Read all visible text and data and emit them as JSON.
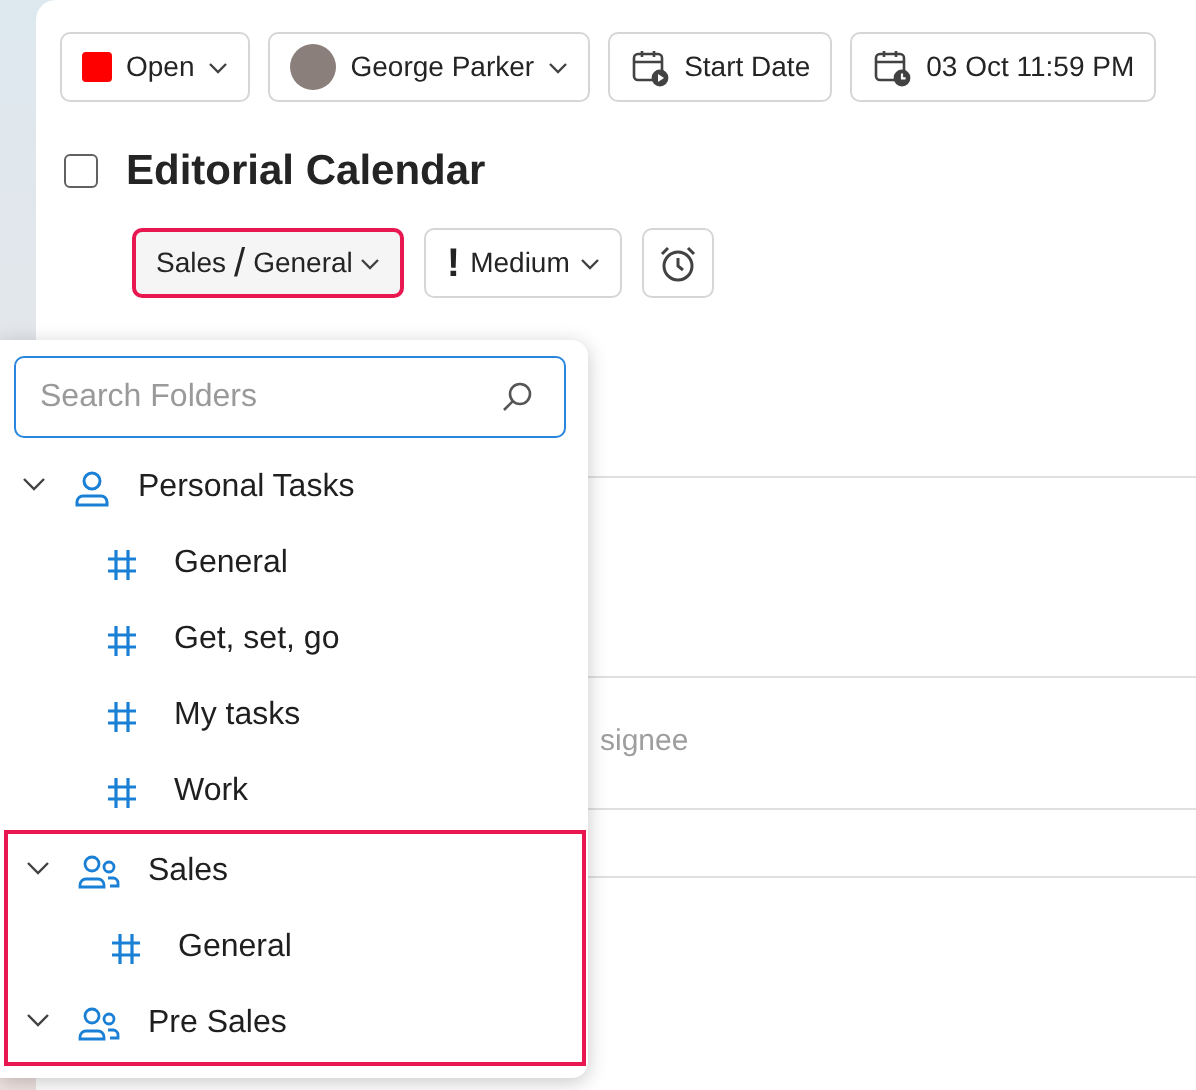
{
  "toolbar": {
    "status": {
      "label": "Open",
      "color": "#ff0000"
    },
    "assignee": {
      "name": "George Parker"
    },
    "start_date": {
      "label": "Start Date"
    },
    "due_date": {
      "label": "03 Oct 11:59 PM"
    }
  },
  "task": {
    "title": "Editorial Calendar",
    "checked": false
  },
  "folder_button": {
    "parent": "Sales",
    "separator": "/",
    "folder": "General",
    "highlighted": true
  },
  "priority_button": {
    "mark": "!",
    "label": "Medium"
  },
  "background_rows": [
    {},
    {},
    {
      "text": "signee"
    },
    {}
  ],
  "folder_picker": {
    "search": {
      "placeholder": "Search Folders"
    },
    "folders": [
      {
        "kind": "personal",
        "label": "Personal Tasks",
        "expanded": true,
        "highlighted": false,
        "children": [
          {
            "label": "General"
          },
          {
            "label": "Get, set, go"
          },
          {
            "label": "My tasks"
          },
          {
            "label": "Work"
          }
        ]
      },
      {
        "kind": "team",
        "label": "Sales",
        "expanded": true,
        "highlighted": true,
        "children": [
          {
            "label": "General"
          }
        ]
      },
      {
        "kind": "team",
        "label": "Pre Sales",
        "expanded": true,
        "highlighted": true
      }
    ]
  }
}
